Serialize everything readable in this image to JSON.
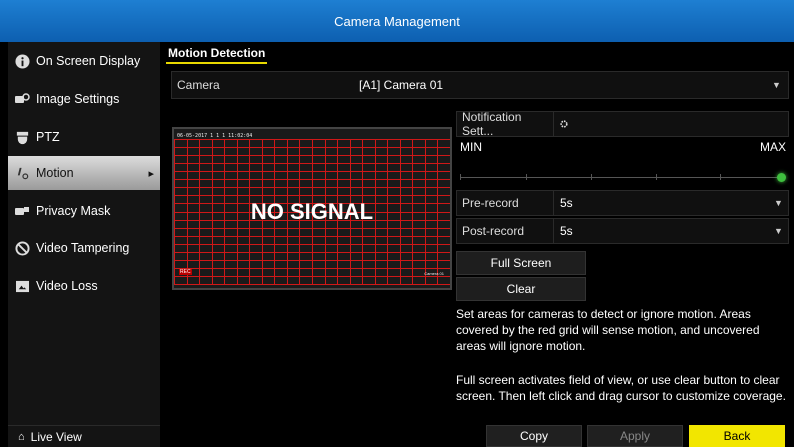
{
  "window": {
    "title": "Camera Management"
  },
  "sidebar": {
    "items": [
      {
        "label": "On Screen Display",
        "icon": "info-icon"
      },
      {
        "label": "Image Settings",
        "icon": "image-settings-icon"
      },
      {
        "label": "PTZ",
        "icon": "ptz-icon"
      },
      {
        "label": "Motion",
        "icon": "motion-icon",
        "active": true
      },
      {
        "label": "Privacy Mask",
        "icon": "privacy-mask-icon"
      },
      {
        "label": "Video Tampering",
        "icon": "tampering-icon"
      },
      {
        "label": "Video Loss",
        "icon": "video-loss-icon"
      }
    ],
    "live_view": "Live View"
  },
  "tab": {
    "label": "Motion Detection"
  },
  "camera": {
    "label": "Camera",
    "value": "[A1] Camera 01"
  },
  "preview": {
    "no_signal": "NO SIGNAL",
    "grid_color": "#d01818"
  },
  "notification": {
    "label": "Notification Sett..."
  },
  "sensitivity": {
    "min_label": "MIN",
    "max_label": "MAX",
    "level": 1.0
  },
  "prerecord": {
    "label": "Pre-record",
    "value": "5s"
  },
  "postrecord": {
    "label": "Post-record",
    "value": "5s"
  },
  "buttons": {
    "full_screen": "Full Screen",
    "clear": "Clear",
    "copy": "Copy",
    "apply": "Apply",
    "back": "Back"
  },
  "description": {
    "p1": "Set areas for cameras to detect or ignore motion. Areas covered by the red grid will sense motion, and uncovered areas will ignore motion.",
    "p2": "Full screen activates field of view, or use clear button to clear screen. Then left click and drag cursor to customize coverage."
  },
  "colors": {
    "accent": "#f2e600",
    "title_bar": "#1670c4",
    "active_knob": "#3fbf3f"
  }
}
